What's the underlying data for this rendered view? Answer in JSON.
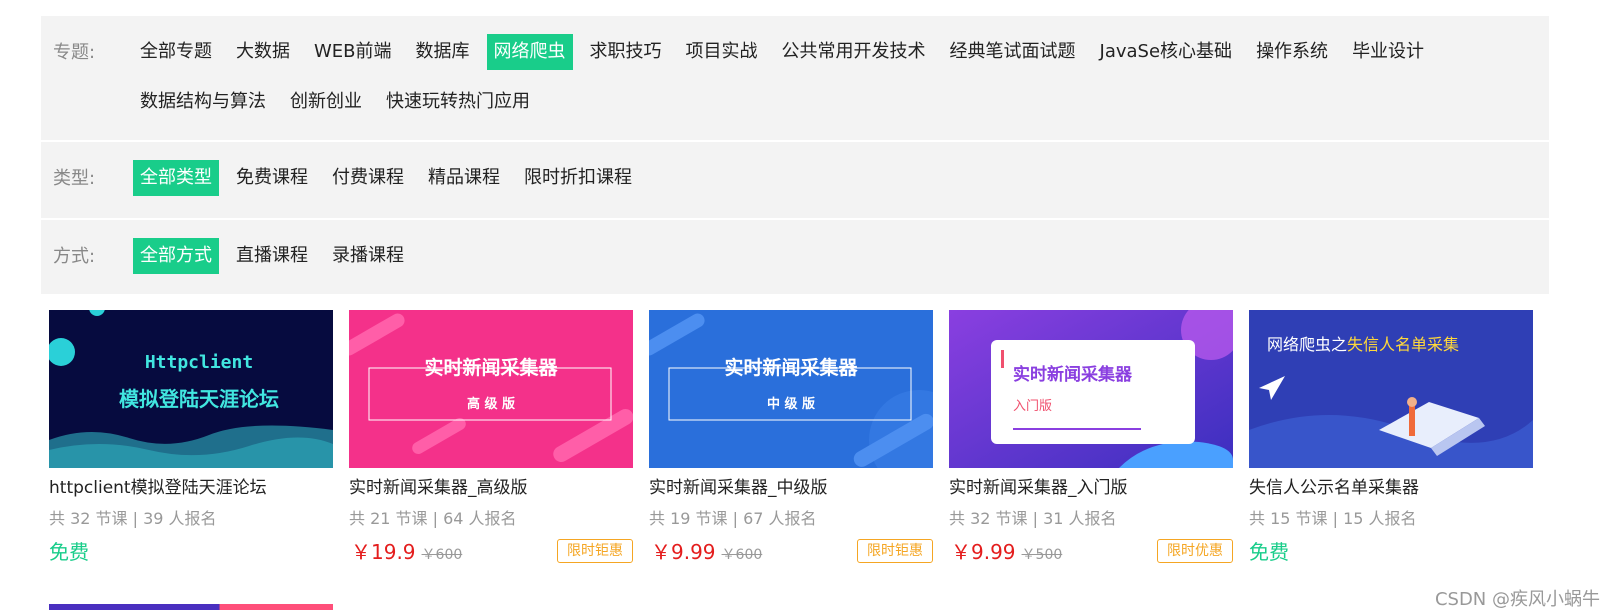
{
  "filters": {
    "topic": {
      "label": "专题:",
      "options": [
        "全部专题",
        "大数据",
        "WEB前端",
        "数据库",
        "网络爬虫",
        "求职技巧",
        "项目实战",
        "公共常用开发技术",
        "经典笔试面试题",
        "JavaSe核心基础",
        "操作系统",
        "毕业设计",
        "数据结构与算法",
        "创新创业",
        "快速玩转热门应用"
      ],
      "active": "网络爬虫"
    },
    "type": {
      "label": "类型:",
      "options": [
        "全部类型",
        "免费课程",
        "付费课程",
        "精品课程",
        "限时折扣课程"
      ],
      "active": "全部类型"
    },
    "mode": {
      "label": "方式:",
      "options": [
        "全部方式",
        "直播课程",
        "录播课程"
      ],
      "active": "全部方式"
    }
  },
  "courses": [
    {
      "thumb": {
        "line1": "Httpclient",
        "line2": "模拟登陆天涯论坛"
      },
      "title": "httpclient模拟登陆天涯论坛",
      "meta": "共 32 节课 | 39 人报名",
      "free_label": "免费"
    },
    {
      "thumb": {
        "line1": "实时新闻采集器",
        "line2": "高 级 版"
      },
      "title": "实时新闻采集器_高级版",
      "meta": "共 21 节课 | 64 人报名",
      "price": "￥19.9",
      "orig_price": "￥600",
      "badge": "限时钜惠"
    },
    {
      "thumb": {
        "line1": "实时新闻采集器",
        "line2": "中 级 版"
      },
      "title": "实时新闻采集器_中级版",
      "meta": "共 19 节课 | 67 人报名",
      "price": "￥9.99",
      "orig_price": "￥600",
      "badge": "限时钜惠"
    },
    {
      "thumb": {
        "line1": "实时新闻采集器",
        "line2": "入门版"
      },
      "title": "实时新闻采集器_入门版",
      "meta": "共 32 节课 | 31 人报名",
      "price": "￥9.99",
      "orig_price": "￥500",
      "badge": "限时优惠"
    },
    {
      "thumb": {
        "line1": "网络爬虫之",
        "line2": "失信人名单采集"
      },
      "title": "失信人公示名单采集器",
      "meta": "共 15 节课 | 15 人报名",
      "free_label": "免费"
    }
  ],
  "watermark": "CSDN @疾风小蜗牛",
  "colors": {
    "accent": "#19cd8a",
    "price": "#e41d1d",
    "badge": "#f5a623"
  }
}
